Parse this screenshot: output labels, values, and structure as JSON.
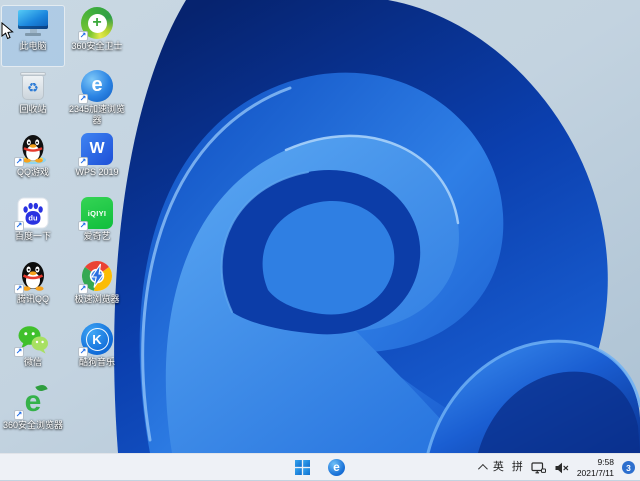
{
  "wallpaper": {
    "style": "windows-11-bloom",
    "bg_top": "#c9d8e3",
    "bg_bottom": "#aec3d4",
    "bloom_dark": "#06236f",
    "bloom_mid": "#2f7fe6",
    "bloom_light": "#5aa7f2"
  },
  "desktop": {
    "icons": [
      {
        "label": "此电脑",
        "selected": true
      },
      {
        "label": "360安全卫士",
        "selected": false
      },
      {
        "label": "回收站",
        "selected": false
      },
      {
        "label": "2345加速浏览器",
        "selected": false
      },
      {
        "label": "QQ游戏",
        "selected": false
      },
      {
        "label": "WPS 2019",
        "selected": false
      },
      {
        "label": "百度一下",
        "selected": false
      },
      {
        "label": "爱奇艺",
        "selected": false
      },
      {
        "label": "腾讯QQ",
        "selected": false
      },
      {
        "label": "极速浏览器",
        "selected": false
      },
      {
        "label": "微信",
        "selected": false
      },
      {
        "label": "酷狗音乐",
        "selected": false
      },
      {
        "label": "360安全浏览器",
        "selected": false
      }
    ]
  },
  "taskbar": {
    "icons": [
      "start",
      "browser-e"
    ],
    "tray": {
      "lang_en": "英",
      "lang_pinyin": "拼",
      "time": "9:58",
      "date": "2021/7/11",
      "badge_count": "3"
    }
  },
  "icon_glyphs": {
    "shortcut": "↗",
    "plus": "+",
    "recycle": "♻",
    "e_2345": "e",
    "wps": "W",
    "baidu": "du",
    "iqiyi": "iQIYI",
    "kugou": "K",
    "e_360": "e",
    "e_taskbar": "e"
  },
  "colors": {
    "taskbar_bg": "#eef1f6",
    "start_blue": "#1c8be0",
    "badge_blue": "#2d6fce",
    "selection": "rgba(140,185,230,0.42)"
  }
}
